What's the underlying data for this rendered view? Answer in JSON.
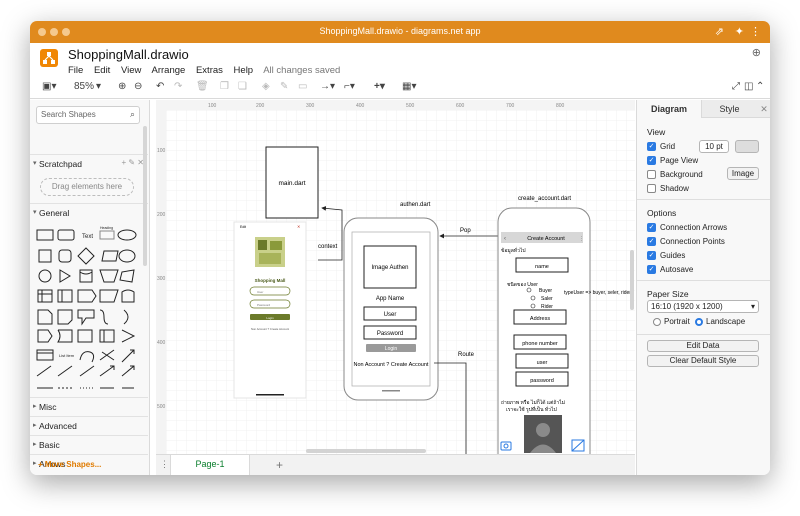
{
  "window": {
    "title": "ShoppingMall.drawio - diagrams.net app"
  },
  "header": {
    "filename": "ShoppingMall.drawio",
    "menu": [
      "File",
      "Edit",
      "View",
      "Arrange",
      "Extras",
      "Help"
    ],
    "save_status": "All changes saved"
  },
  "toolbar": {
    "zoom": "85%"
  },
  "sidebar": {
    "search_placeholder": "Search Shapes",
    "scratchpad": "Scratchpad",
    "drag_hint": "Drag elements here",
    "general": "General",
    "shape_text": "Text",
    "shape_heading": "Heading",
    "shape_list": "List Item",
    "categories": [
      "Misc",
      "Advanced",
      "Basic",
      "Arrows"
    ],
    "more_shapes": "+ More Shapes..."
  },
  "pages": {
    "current": "Page-1"
  },
  "ruler": {
    "x": [
      "100",
      "200",
      "300",
      "400",
      "500",
      "600",
      "700",
      "800"
    ],
    "y": [
      "100",
      "200",
      "300",
      "400",
      "500"
    ]
  },
  "canvas": {
    "main_dart": "main.dart",
    "authen_title": "authen.dart",
    "create_title": "create_account.dart",
    "context": "context",
    "pop": "Pop",
    "route": "Route",
    "image_authen": "Image Authen",
    "app_name": "App Name",
    "user": "User",
    "password": "Password",
    "login": "Login",
    "non_account": "Non Account ? Create Account",
    "create_account": "Create Account",
    "fill_info": "ข้อมูลทั่วไป",
    "name": "name",
    "user_type": "ชนิดของ User",
    "buyer": "Buyer",
    "saler": "Saler",
    "rider": "Rider",
    "type_note": "typeUser => buyer, seler, rider",
    "address": "Address",
    "phone": "phone number",
    "user_field": "user",
    "password_field": "password",
    "photo_note_1": "ถ่ายภาพ หรือ ไม่ก็ได้ แต่ถ้าไม่",
    "photo_note_2": "เราจะใช้ รูปที่เป็น ทั่วไป",
    "shop_title": "Shopping Mall",
    "shop_edit": "Edit",
    "shop_user_ph": "User",
    "shop_pass_ph": "Password",
    "shop_login": "Login",
    "shop_non_account": "Non Account ? Create Account"
  },
  "right_panel": {
    "tabs": [
      "Diagram",
      "Style"
    ],
    "view_heading": "View",
    "grid": "Grid",
    "grid_size": "10 pt",
    "page_view": "Page View",
    "background": "Background",
    "image_btn": "Image",
    "shadow": "Shadow",
    "options_heading": "Options",
    "connection_arrows": "Connection Arrows",
    "connection_points": "Connection Points",
    "guides": "Guides",
    "autosave": "Autosave",
    "paper_size_heading": "Paper Size",
    "paper_size": "16:10 (1920 x 1200)",
    "portrait": "Portrait",
    "landscape": "Landscape",
    "edit_data": "Edit Data",
    "clear_style": "Clear Default Style"
  },
  "colors": {
    "titlebar": "#e08a1e",
    "accent": "#2a7ae2",
    "logo": "#f08705",
    "shop_green": "#6b7a2a"
  }
}
